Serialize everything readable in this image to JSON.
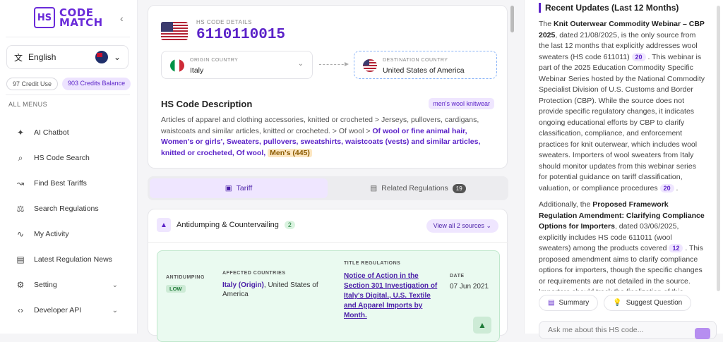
{
  "logo": {
    "mark": "HS",
    "line1": "CODE",
    "line2": "MATCH"
  },
  "language": "English",
  "credits": {
    "used": "97 Credit Use",
    "balance": "903 Credits Balance"
  },
  "menu_title": "ALL MENUS",
  "menu": [
    {
      "label": "AI Chatbot",
      "icon": "✦"
    },
    {
      "label": "HS Code Search",
      "icon": "⌕"
    },
    {
      "label": "Find Best Tariffs",
      "icon": "↝"
    },
    {
      "label": "Search Regulations",
      "icon": "⚖"
    },
    {
      "label": "My Activity",
      "icon": "∿"
    },
    {
      "label": "Latest Regulation News",
      "icon": "▤"
    },
    {
      "label": "Setting",
      "icon": "⚙"
    },
    {
      "label": "Developer API",
      "icon": "‹›"
    }
  ],
  "hs": {
    "label": "HS CODE DETAILS",
    "code": "6110110015"
  },
  "origin": {
    "label": "ORIGIN COUNTRY",
    "value": "Italy"
  },
  "destination": {
    "label": "DESTINATION COUNTRY",
    "value": "United States of America"
  },
  "description": {
    "title": "HS Code Description",
    "tag": "men's wool knitwear",
    "plain": "Articles of apparel and clothing accessories, knitted or crocheted  >  Jerseys, pullovers, cardigans, waistcoats and similar articles, knitted or crocheted.  >  Of wool  >",
    "highlight": "Of wool or fine animal hair, Women's or girls', Sweaters, pullovers, sweatshirts, waistcoats (vests) and similar articles, knitted or crocheted, Of wool,",
    "men": "Men's (445)"
  },
  "tabs": {
    "tariff": "Tariff",
    "related": "Related Regulations",
    "related_count": "19"
  },
  "antidumping": {
    "title": "Antidumping & Countervailing",
    "count": "2",
    "view_all": "View all 2 sources",
    "col_antidumping": "ANTIDUMPING",
    "level": "LOW",
    "col_affected": "AFFECTED COUNTRIES",
    "affected_bold": "Italy (Origin)",
    "affected_rest": ", United States of America",
    "col_title": "TITLE REGULATIONS",
    "regulations": "Notice of Action in the Section 301 Investigation of Italy's Digital., U.S. Textile and Apparel Imports by Month.",
    "col_date": "DATE",
    "date": "07 Jun 2021"
  },
  "updates": {
    "title": "Recent Updates (Last 12 Months)",
    "p1_pre": "The ",
    "p1_bold": "Knit Outerwear Commodity Webinar – CBP 2025",
    "p1_text": ", dated 21/08/2025, is the only source from the last 12 months that explicitly addresses wool sweaters (HS code 611011) ",
    "p1_cite1": "20",
    "p1_text2": " . This webinar is part of the 2025 Education Commodity Specific Webinar Series hosted by the National Commodity Specialist Division of U.S. Customs and Border Protection (CBP). While the source does not provide specific regulatory changes, it indicates ongoing educational efforts by CBP to clarify classification, compliance, and enforcement practices for knit outerwear, which includes wool sweaters. Importers of wool sweaters from Italy should monitor updates from this webinar series for potential guidance on tariff classification, valuation, or compliance procedures ",
    "p1_cite2": "20",
    "p1_end": " .",
    "p2_pre": "Additionally, the ",
    "p2_bold": "Proposed Framework Regulation Amendment: Clarifying Compliance Options for Importers",
    "p2_text": ", dated 03/06/2025, explicitly includes HS code 611011 (wool sweaters) among the products covered ",
    "p2_cite": "12",
    "p2_text2": " . This proposed amendment aims to clarify compliance options for importers, though the specific changes or requirements are not detailed in the source. Importers should track the finalization of this"
  },
  "buttons": {
    "summary": "Summary",
    "suggest": "Suggest Question"
  },
  "ask": {
    "placeholder": "Ask me about this HS code..."
  }
}
